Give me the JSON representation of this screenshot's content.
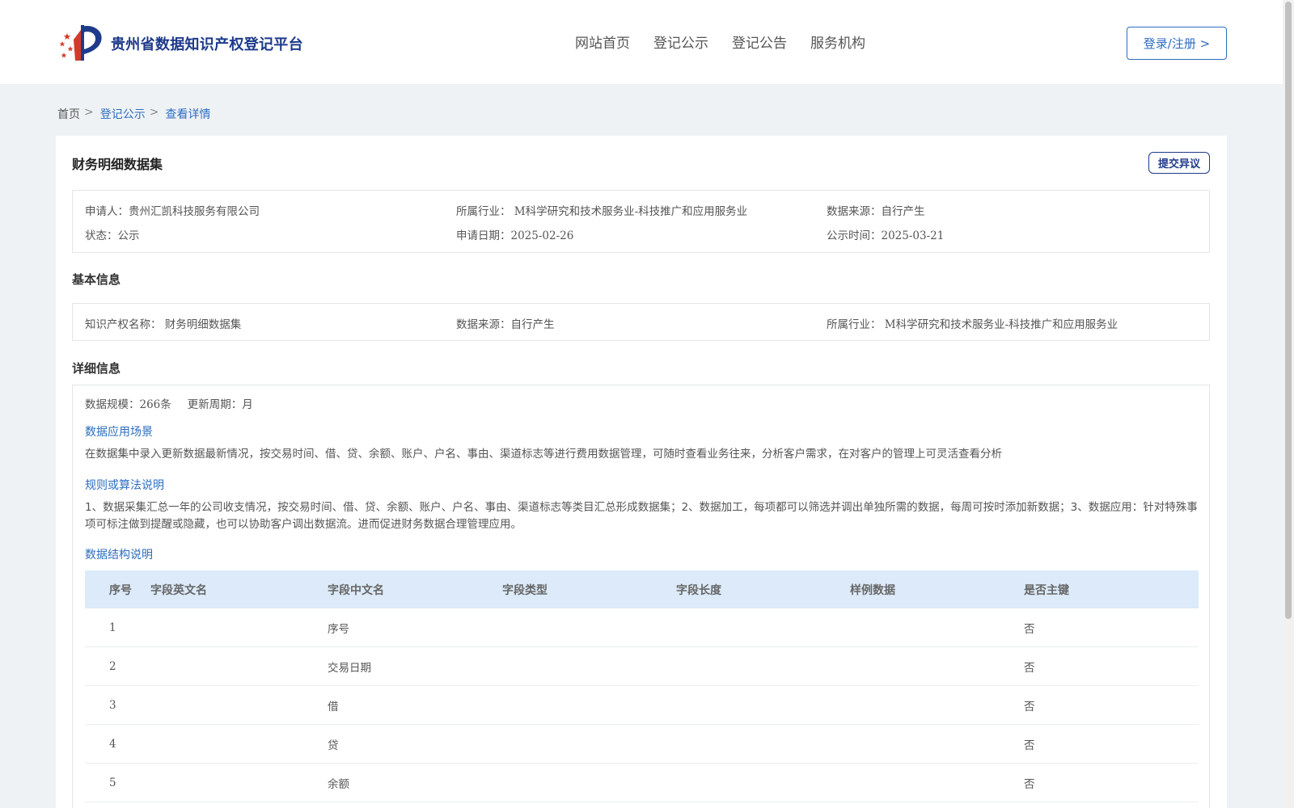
{
  "header": {
    "site_title": "贵州省数据知识产权登记平台",
    "nav": [
      "网站首页",
      "登记公示",
      "登记公告",
      "服务机构"
    ],
    "login_label": "登录/注册 >"
  },
  "breadcrumb": {
    "home": "首页",
    "sep": ">",
    "level2": "登记公示",
    "current": "查看详情"
  },
  "card": {
    "title": "财务明细数据集",
    "objection_label": "提交异议",
    "summary": {
      "applicant_label": "申请人：",
      "applicant": "贵州汇凯科技服务有限公司",
      "industry_label": "所属行业：",
      "industry": "M科学研究和技术服务业-科技推广和应用服务业",
      "source_label": "数据来源：",
      "source": "自行产生",
      "status_label": "状态：",
      "status": "公示",
      "apply_date_label": "申请日期：",
      "apply_date": "2025-02-26",
      "publish_time_label": "公示时间：",
      "publish_time": "2025-03-21"
    },
    "basic": {
      "title": "基本信息",
      "ip_name_label": "知识产权名称：",
      "ip_name": "财务明细数据集",
      "source_label": "数据来源：",
      "source": "自行产生",
      "industry_label": "所属行业：",
      "industry": "M科学研究和技术服务业-科技推广和应用服务业"
    },
    "detail": {
      "title": "详细信息",
      "scale_label": "数据规模：",
      "scale": "266条",
      "cycle_label": "更新周期：",
      "cycle": "月",
      "scenario_title": "数据应用场景",
      "scenario_text": "在数据集中录入更新数据最新情况，按交易时间、借、贷、余额、账户、户名、事由、渠道标志等进行费用数据管理，可随时查看业务往来，分析客户需求，在对客户的管理上可灵活查看分析",
      "rule_title": "规则或算法说明",
      "rule_text": "1、数据采集汇总一年的公司收支情况，按交易时间、借、贷、余额、账户、户名、事由、渠道标志等类目汇总形成数据集；2、数据加工，每项都可以筛选并调出单独所需的数据，每周可按时添加新数据；3、数据应用：针对特殊事项可标注做到提醒或隐藏，也可以协助客户调出数据流。进而促进财务数据合理管理应用。",
      "structure_title": "数据结构说明",
      "table": {
        "headers": [
          "序号",
          "字段英文名",
          "字段中文名",
          "字段类型",
          "字段长度",
          "样例数据",
          "是否主键"
        ],
        "rows": [
          [
            "1",
            "",
            "序号",
            "",
            "",
            "",
            "否"
          ],
          [
            "2",
            "",
            "交易日期",
            "",
            "",
            "",
            "否"
          ],
          [
            "3",
            "",
            "借",
            "",
            "",
            "",
            "否"
          ],
          [
            "4",
            "",
            "贷",
            "",
            "",
            "",
            "否"
          ],
          [
            "5",
            "",
            "余额",
            "",
            "",
            "",
            "否"
          ]
        ]
      }
    }
  },
  "colors": {
    "brand": "#1e3a8a",
    "link": "#2c6dc0",
    "table_header_bg": "#dceaf9",
    "page_bg": "#eff2f5"
  }
}
